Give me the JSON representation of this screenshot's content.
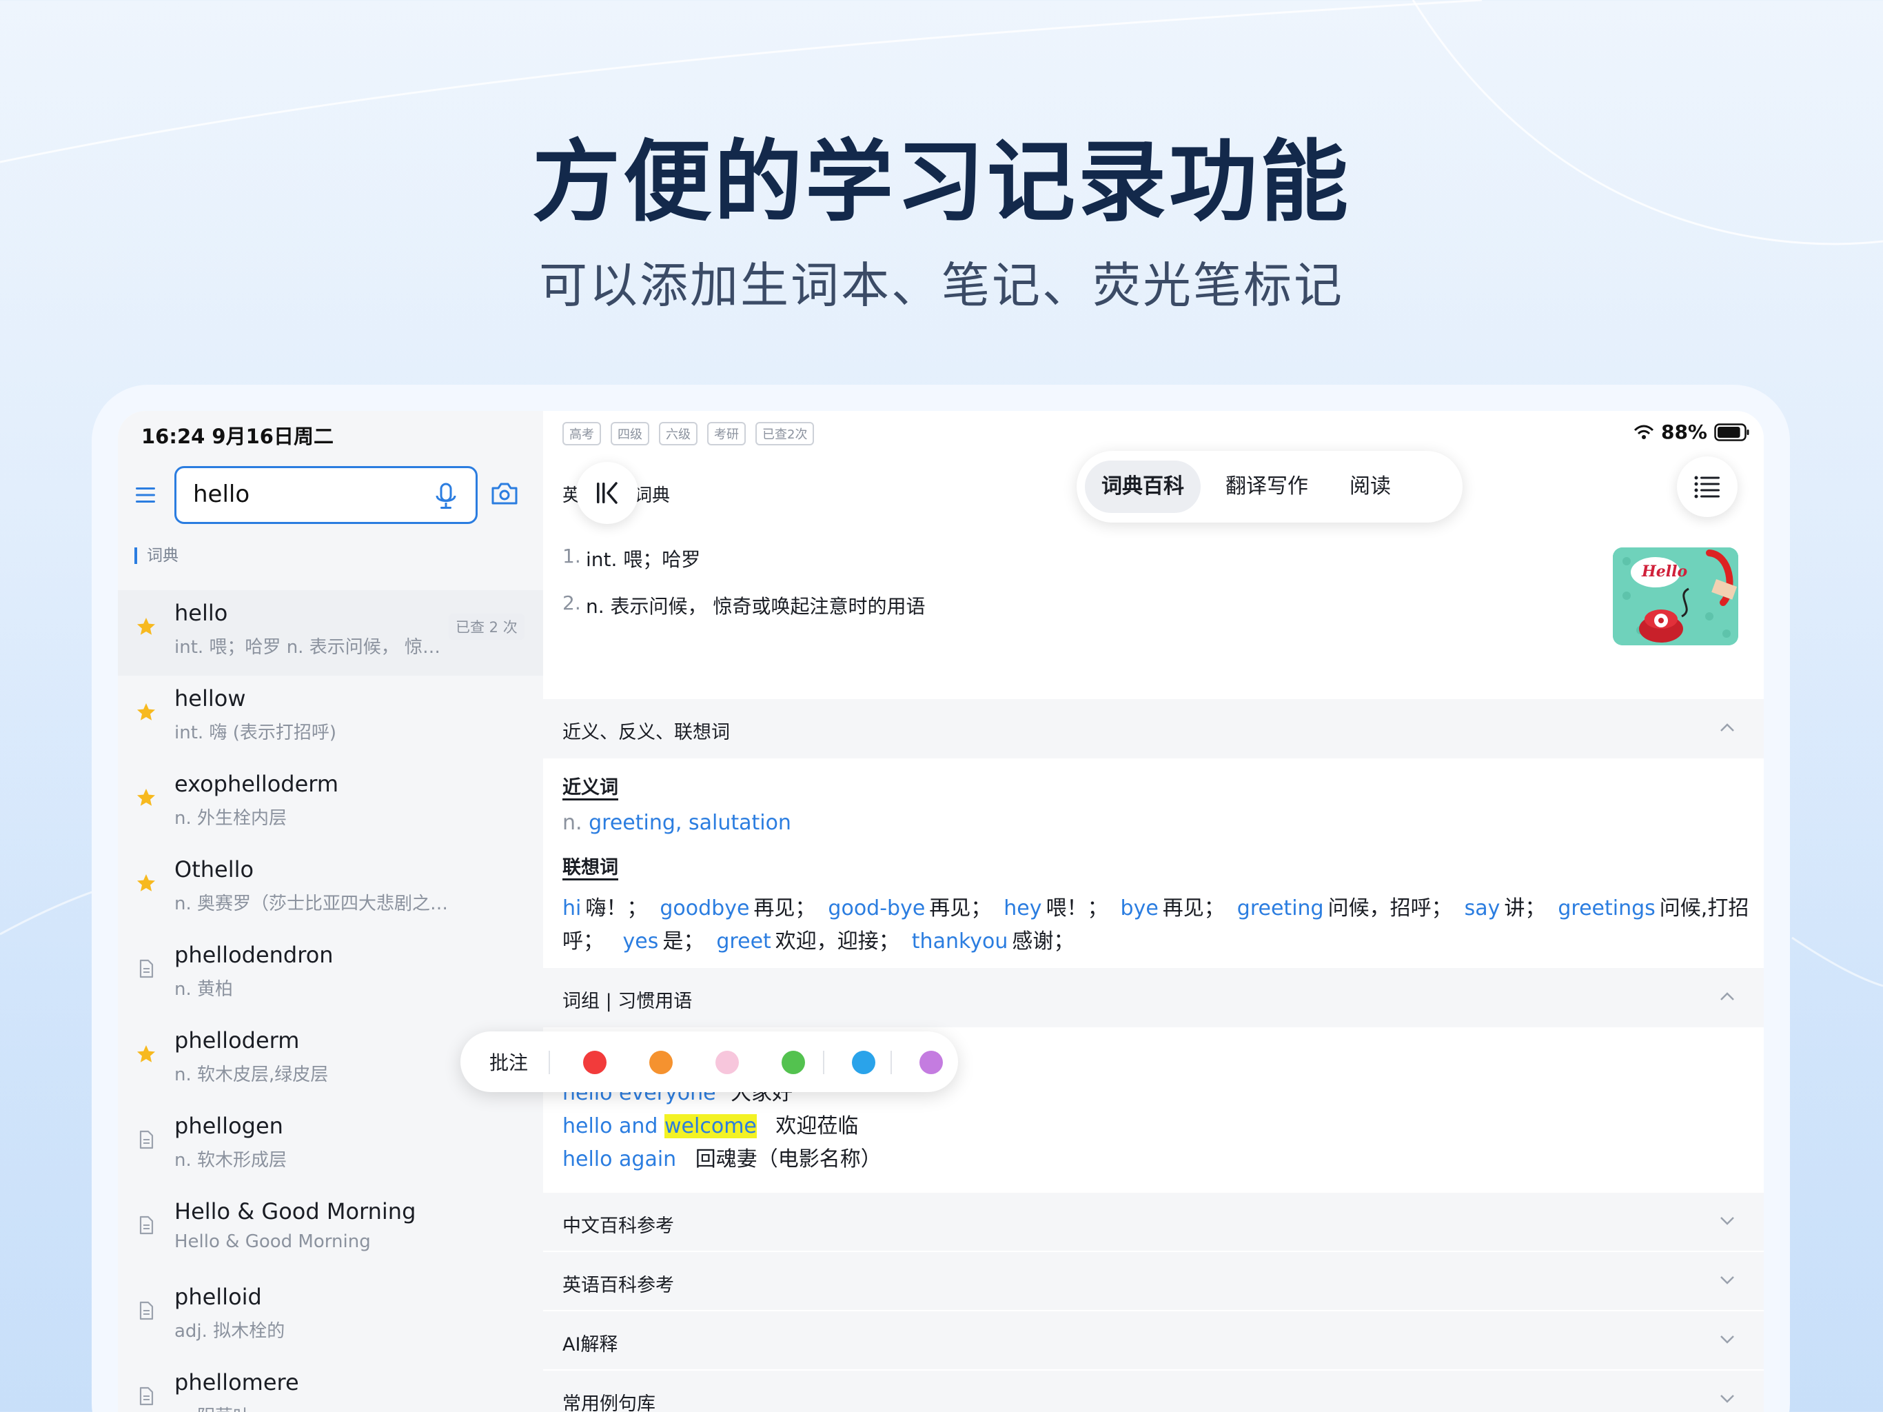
{
  "hero": {
    "title": "方便的学习记录功能",
    "subtitle": "可以添加生词本、笔记、荧光笔标记"
  },
  "status_bar": {
    "time_date": "16:24  9月16日周二",
    "battery_text": "88%",
    "battery_level_percent": 88
  },
  "search": {
    "value": "hello"
  },
  "sidebar": {
    "section_label": "词典",
    "items": [
      {
        "word": "hello",
        "def": "int. 喂；哈罗 n. 表示问候， 惊…",
        "icon": "star-icon",
        "badge": "已查 2 次"
      },
      {
        "word": "hellow",
        "def": "int. 嗨 (表示打招呼)",
        "icon": "star-icon"
      },
      {
        "word": "exophelloderm",
        "def": "n. 外生栓内层",
        "icon": "star-icon"
      },
      {
        "word": "Othello",
        "def": "n. 奥赛罗（莎士比亚四大悲剧之一）",
        "icon": "star-icon"
      },
      {
        "word": "phellodendron",
        "def": "n. 黄柏",
        "icon": "document-icon"
      },
      {
        "word": "phelloderm",
        "def": "n. 软木皮层,绿皮层",
        "icon": "star-icon"
      },
      {
        "word": "phellogen",
        "def": "n. 软木形成层",
        "icon": "document-icon"
      },
      {
        "word": "Hello & Good Morning",
        "def": "Hello & Good Morning",
        "icon": "document-icon"
      },
      {
        "word": "phelloid",
        "def": "adj. 拟木栓的",
        "icon": "document-icon"
      },
      {
        "word": "phellomere",
        "def": "n. 阴茎叶",
        "icon": "document-icon"
      }
    ]
  },
  "main": {
    "tags": [
      "高考",
      "四级",
      "六级",
      "考研",
      "已查2次"
    ],
    "dict_title": "英汉英汉词典",
    "tabs": [
      {
        "label": "词典百科",
        "active": true
      },
      {
        "label": "翻译写作",
        "active": false
      },
      {
        "label": "阅读",
        "active": false
      }
    ],
    "definitions": [
      {
        "num": "1.",
        "text": "int. 喂；哈罗"
      },
      {
        "num": "2.",
        "text": "n. 表示问候， 惊奇或唤起注意时的用语"
      }
    ],
    "image_text": "Hello",
    "synonym_section": {
      "header": "近义、反义、联想词",
      "synonym_label": "近义词",
      "synonym_pos": "n.",
      "synonyms": "greeting, salutation",
      "assoc_label": "联想词",
      "assoc_line1": [
        {
          "w": "hi",
          "m": "嗨！；"
        },
        {
          "w": "goodbye",
          "m": "再见；"
        },
        {
          "w": "good-bye",
          "m": "再见；"
        },
        {
          "w": "hey",
          "m": "喂！；"
        },
        {
          "w": "bye",
          "m": "再见；"
        },
        {
          "w": "greeting",
          "m": "问候，招呼；"
        },
        {
          "w": "say",
          "m": "讲；"
        },
        {
          "w": "greetings",
          "m": "问候,打招"
        }
      ],
      "assoc_line2_prefix": "呼；",
      "assoc_line2": [
        {
          "w": "yes",
          "m": "是；"
        },
        {
          "w": "greet",
          "m": "欢迎，迎接；"
        },
        {
          "w": "thankyou",
          "m": "感谢；"
        }
      ]
    },
    "phrase_section": {
      "header": "词组 | 习惯用语",
      "phrases": [
        {
          "p": "hello everyone",
          "m": "大家好"
        },
        {
          "p1": "hello and ",
          "p2": "welcome",
          "m": "欢迎莅临"
        },
        {
          "p": "hello again",
          "m": "回魂妻（电影名称）"
        }
      ]
    },
    "collapsed_sections": [
      "中文百科参考",
      "英语百科参考",
      "AI解释",
      "常用例句库"
    ]
  },
  "annotation_bar": {
    "label": "批注",
    "colors": [
      "#f23b3b",
      "#f5922f",
      "#f7c6dc",
      "#53c24f",
      "#2aa3ea",
      "#c47ce0"
    ]
  }
}
